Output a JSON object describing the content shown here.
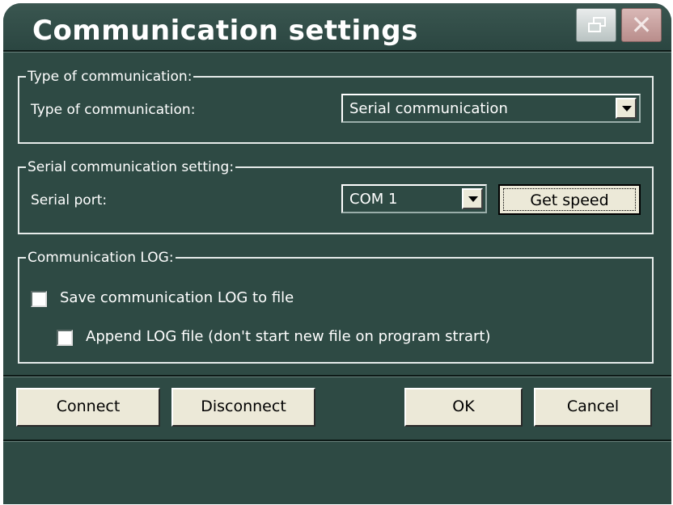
{
  "window": {
    "title": "Communication settings"
  },
  "type_group": {
    "legend": "Type of communication:",
    "label": "Type of communication:",
    "selected": "Serial communication"
  },
  "serial_group": {
    "legend": "Serial communication setting:",
    "port_label": "Serial port:",
    "port_selected": "COM 1",
    "get_speed_label": "Get speed"
  },
  "log_group": {
    "legend": "Communication LOG:",
    "save_label": "Save communication LOG to file",
    "append_label": "Append LOG file (don't start new file on program strart)"
  },
  "buttons": {
    "connect": "Connect",
    "disconnect": "Disconnect",
    "ok": "OK",
    "cancel": "Cancel"
  },
  "icons": {
    "restore": "restore-icon",
    "close": "close-icon"
  },
  "colors": {
    "background": "#2e4a44",
    "button_face": "#ece9d8"
  }
}
